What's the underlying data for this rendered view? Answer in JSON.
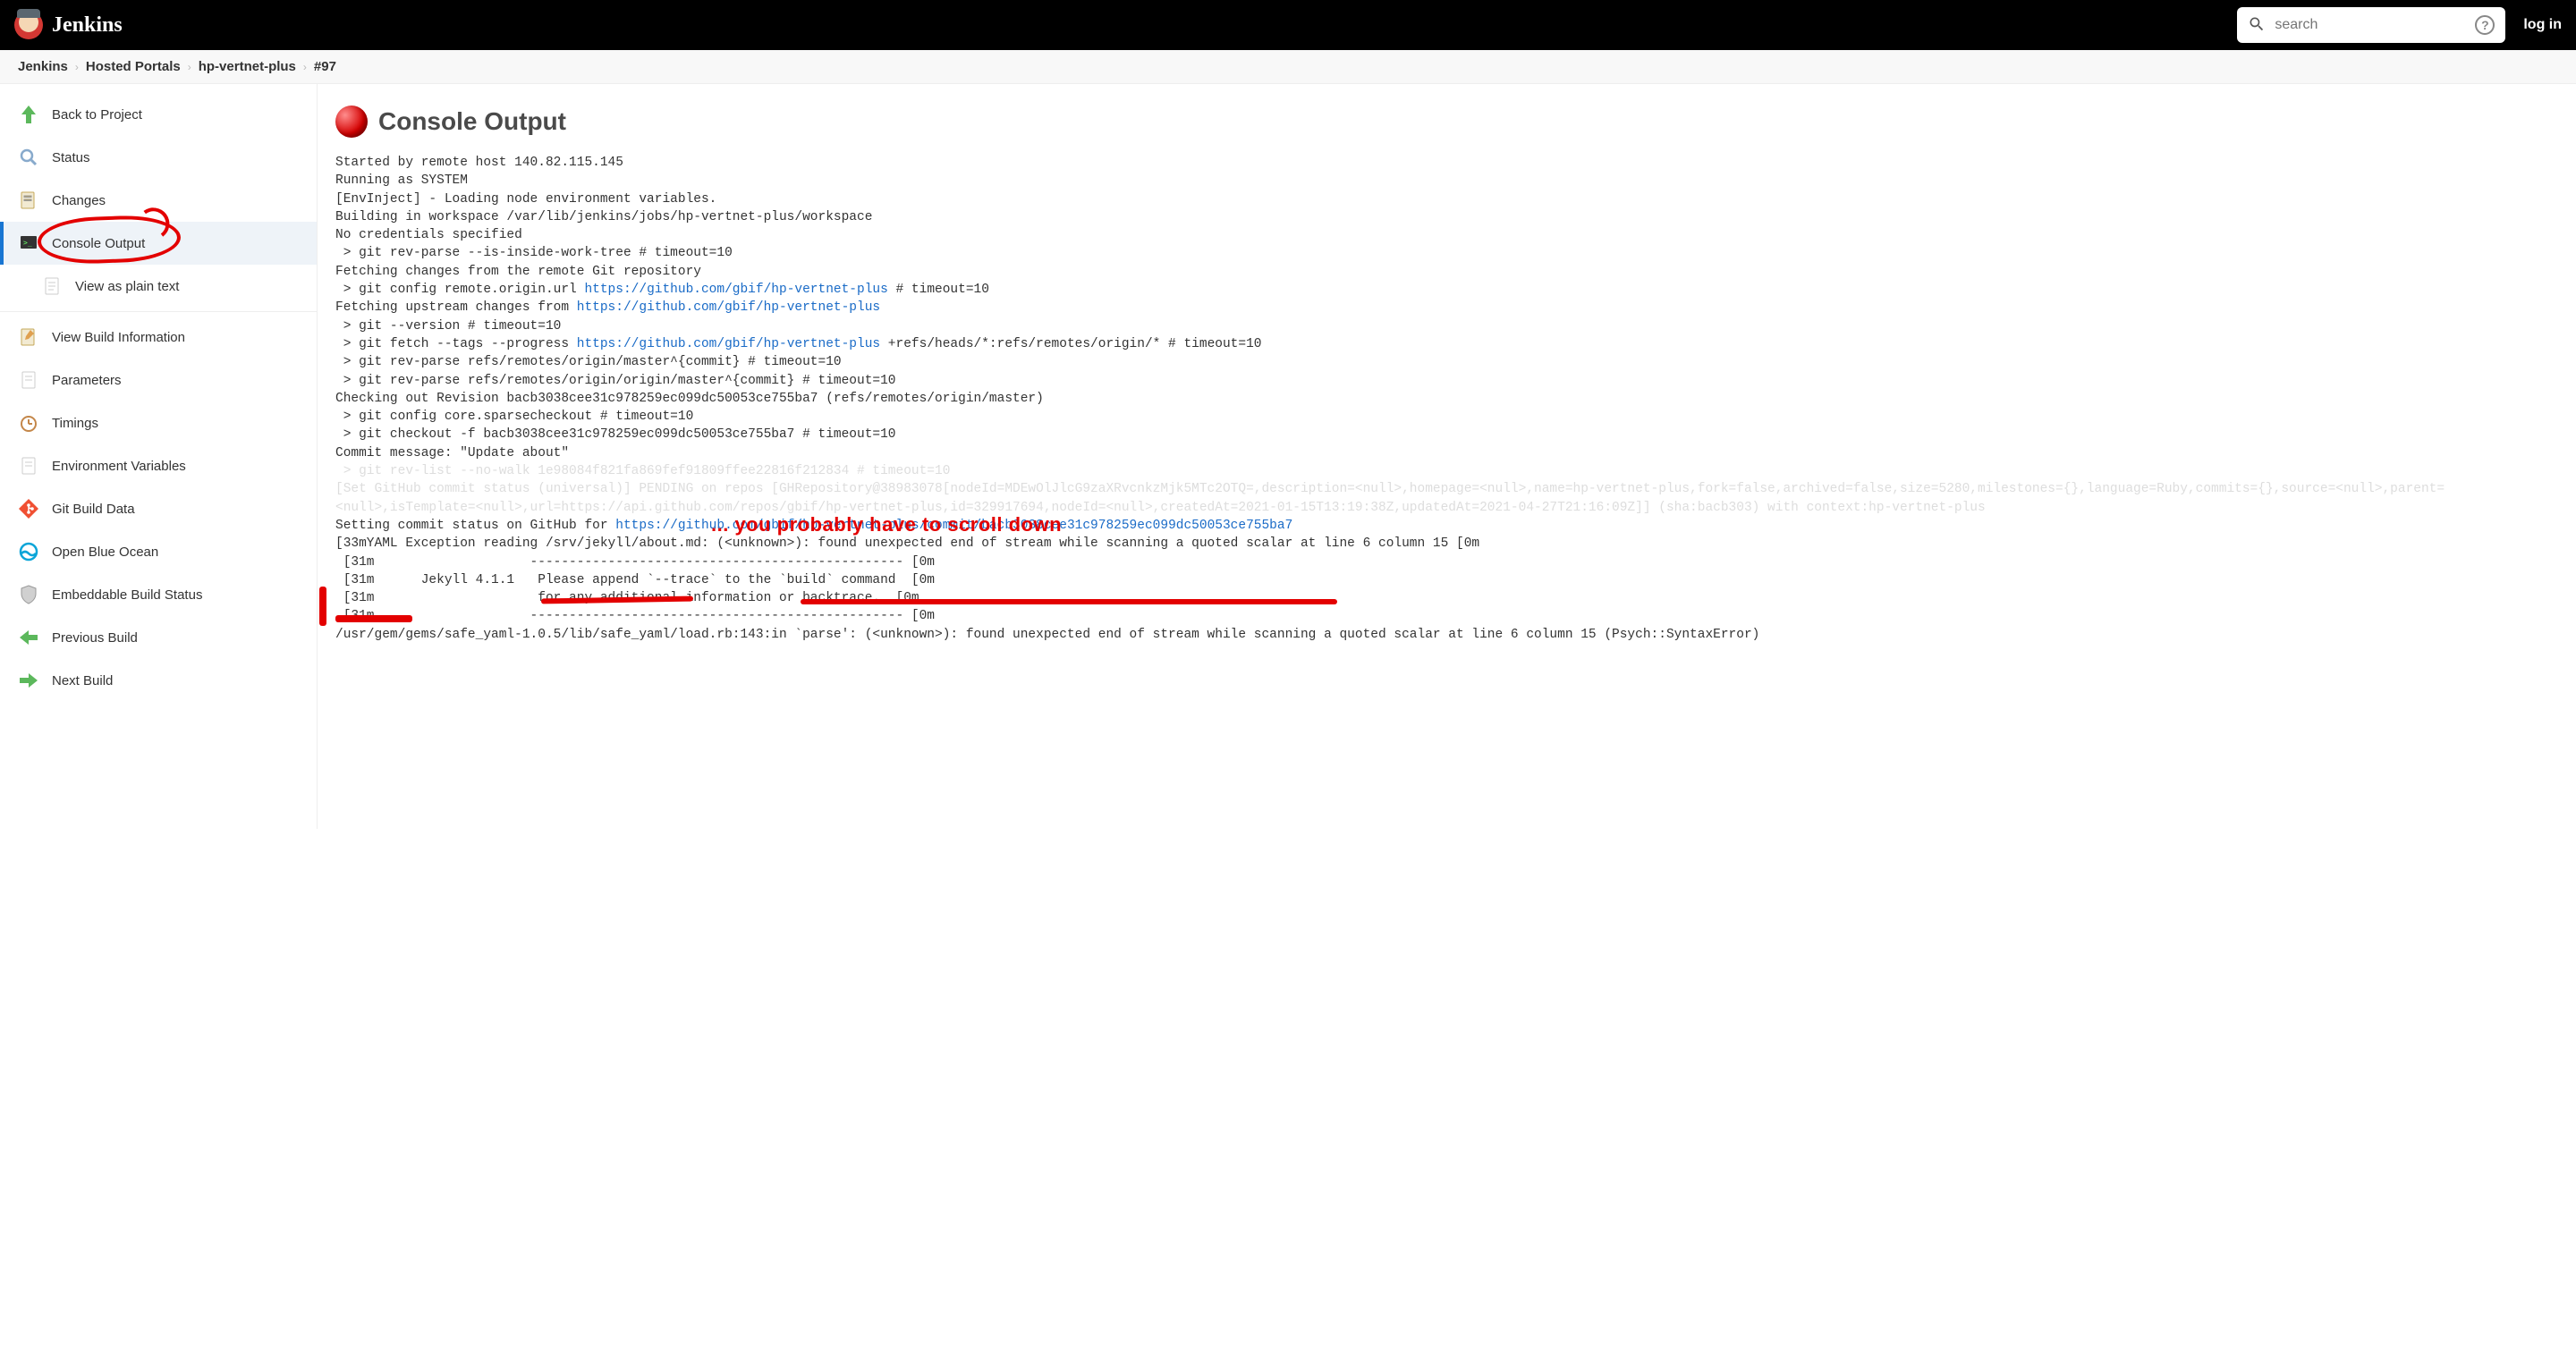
{
  "header": {
    "brand": "Jenkins",
    "search_placeholder": "search",
    "login": "log in"
  },
  "breadcrumbs": [
    "Jenkins",
    "Hosted Portals",
    "hp-vertnet-plus",
    "#97"
  ],
  "sidebar": {
    "items": [
      {
        "label": "Back to Project"
      },
      {
        "label": "Status"
      },
      {
        "label": "Changes"
      },
      {
        "label": "Console Output"
      },
      {
        "label": "View as plain text"
      },
      {
        "label": "View Build Information"
      },
      {
        "label": "Parameters"
      },
      {
        "label": "Timings"
      },
      {
        "label": "Environment Variables"
      },
      {
        "label": "Git Build Data"
      },
      {
        "label": "Open Blue Ocean"
      },
      {
        "label": "Embeddable Build Status"
      },
      {
        "label": "Previous Build"
      },
      {
        "label": "Next Build"
      }
    ]
  },
  "page": {
    "title": "Console Output"
  },
  "annotation": {
    "scroll_hint": "... you probably have to scroll down"
  },
  "console": {
    "line1": "Started by remote host 140.82.115.145",
    "line2": "Running as SYSTEM",
    "line3": "[EnvInject] - Loading node environment variables.",
    "line4": "Building in workspace /var/lib/jenkins/jobs/hp-vertnet-plus/workspace",
    "line5": "No credentials specified",
    "line6": " > git rev-parse --is-inside-work-tree # timeout=10",
    "line7": "Fetching changes from the remote Git repository",
    "line8a": " > git config remote.origin.url ",
    "link8": "https://github.com/gbif/hp-vertnet-plus",
    "line8b": " # timeout=10",
    "line9a": "Fetching upstream changes from ",
    "link9": "https://github.com/gbif/hp-vertnet-plus",
    "line10": " > git --version # timeout=10",
    "line11a": " > git fetch --tags --progress ",
    "link11": "https://github.com/gbif/hp-vertnet-plus",
    "line11b": " +refs/heads/*:refs/remotes/origin/* # timeout=10",
    "line12": " > git rev-parse refs/remotes/origin/master^{commit} # timeout=10",
    "line13": " > git rev-parse refs/remotes/origin/origin/master^{commit} # timeout=10",
    "line14": "Checking out Revision bacb3038cee31c978259ec099dc50053ce755ba7 (refs/remotes/origin/master)",
    "line15": " > git config core.sparsecheckout # timeout=10",
    "line16": " > git checkout -f bacb3038cee31c978259ec099dc50053ce755ba7 # timeout=10",
    "line17": "Commit message: \"Update about\"",
    "faded1": " > git rev-list --no-walk 1e98084f821fa869fef91809ffee22816f212834 # timeout=10",
    "faded2": "[Set GitHub commit status (universal)] PENDING on repos [GHRepository@38983078[nodeId=MDEwOlJlcG9zaXRvcnkzMjk5MTc2OTQ=,description=<null>,homepage=<null>,name=hp-vertnet-plus,fork=false,archived=false,size=5280,milestones={},language=Ruby,commits={},source=<null>,parent=<null>,isTemplate=<null>,url=https://api.github.com/repos/gbif/hp-vertnet-plus,id=329917694,nodeId=<null>,createdAt=2021-01-15T13:19:38Z,updatedAt=2021-04-27T21:16:09Z]] (sha:bacb303) with context:hp-vertnet-plus",
    "line18a": "Setting commit status on GitHub for ",
    "link18": "https://github.com/gbif/hp-vertnet-plus/commit/bacb3038cee31c978259ec099dc50053ce755ba7",
    "line19": "[33mYAML Exception reading /srv/jekyll/about.md: (<unknown>): found unexpected end of stream while scanning a quoted scalar at line 6 column 15 [0m",
    "line20": " [31m                    ------------------------------------------------ [0m",
    "line21": " [31m      Jekyll 4.1.1   Please append `--trace` to the `build` command  [0m",
    "line22": " [31m                     for any additional information or backtrace.  [0m",
    "line23": " [31m                    ------------------------------------------------ [0m",
    "line24": "/usr/gem/gems/safe_yaml-1.0.5/lib/safe_yaml/load.rb:143:in `parse': (<unknown>): found unexpected end of stream while scanning a quoted scalar at line 6 column 15 (Psych::SyntaxError)"
  }
}
